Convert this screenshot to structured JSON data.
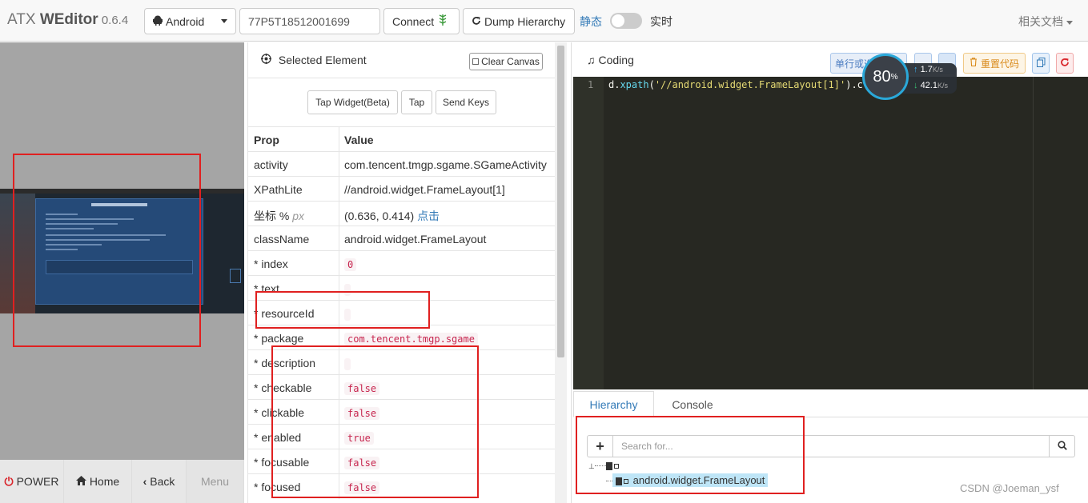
{
  "navbar": {
    "brand_light": "ATX ",
    "brand_bold": "WEditor",
    "brand_version": " 0.6.4",
    "platform": "Android",
    "serial": "77P5T18512001699",
    "connect_label": "Connect",
    "dump_label": "Dump Hierarchy",
    "mode_static": "静态",
    "mode_live": "实时",
    "docs_label": "相关文档"
  },
  "device": {
    "buttons": {
      "power": "POWER",
      "home": "Home",
      "back": "Back",
      "menu": "Menu"
    }
  },
  "element_panel": {
    "title": "Selected Element",
    "clear_canvas": "Clear Canvas",
    "actions": {
      "tap_widget": "Tap Widget(Beta)",
      "tap": "Tap",
      "send_keys": "Send Keys"
    },
    "table_header": {
      "prop": "Prop",
      "value": "Value"
    },
    "rows": [
      {
        "prop": "activity",
        "value": "com.tencent.tmgp.sgame.SGameActivity"
      },
      {
        "prop": "XPathLite",
        "value": "//android.widget.FrameLayout[1]"
      },
      {
        "prop": "坐标 %",
        "prop_suffix": "px",
        "value": "(0.636, 0.414)",
        "value_link": "点击"
      },
      {
        "prop": "className",
        "value": "android.widget.FrameLayout"
      },
      {
        "prop": "* index",
        "value": "0"
      },
      {
        "prop": "* text",
        "value": ""
      },
      {
        "prop": "* resourceId",
        "value": ""
      },
      {
        "prop": "* package",
        "value": "com.tencent.tmgp.sgame"
      },
      {
        "prop": "* description",
        "value": ""
      },
      {
        "prop": "* checkable",
        "value": "false"
      },
      {
        "prop": "* clickable",
        "value": "false"
      },
      {
        "prop": "* enabled",
        "value": "true"
      },
      {
        "prop": "* focusable",
        "value": "false"
      },
      {
        "prop": "* focused",
        "value": "false"
      }
    ]
  },
  "coding": {
    "title": "Coding",
    "run_label": "单行或选中执行",
    "reset_label": "重置代码",
    "line_number": "1",
    "code_prefix": "d.",
    "code_fn": "xpath",
    "code_open": "(",
    "code_str": "'//android.widget.FrameLayout[1]'",
    "code_tail": ").click",
    "speed": {
      "percent": "80",
      "percent_unit": "%",
      "up": "1.7",
      "down": "42.1",
      "unit": "K/s"
    }
  },
  "tabs": {
    "hierarchy": "Hierarchy",
    "console": "Console"
  },
  "hierarchy": {
    "search_placeholder": "Search for...",
    "child_label": "android.widget.FrameLayout"
  },
  "watermark": "CSDN @Joeman_ysf",
  "colors": {
    "accent": "#337ab7",
    "highlight_box": "#e02020",
    "editor_bg": "#272822"
  }
}
